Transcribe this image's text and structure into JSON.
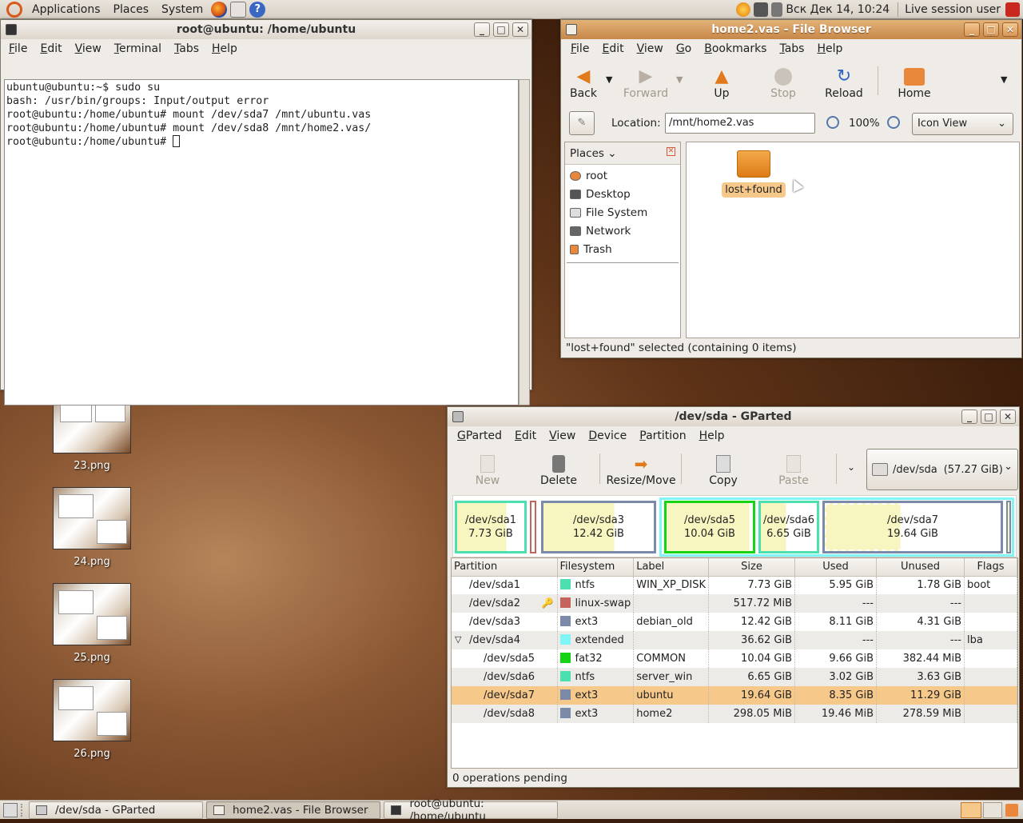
{
  "top_panel": {
    "menus": [
      "Applications",
      "Places",
      "System"
    ],
    "clock": "Вск Дек 14, 10:24",
    "session": "Live session user"
  },
  "terminal": {
    "title": "root@ubuntu: /home/ubuntu",
    "menu": [
      "File",
      "Edit",
      "View",
      "Terminal",
      "Tabs",
      "Help"
    ],
    "lines": [
      "ubuntu@ubuntu:~$ sudo su",
      "bash: /usr/bin/groups: Input/output error",
      "root@ubuntu:/home/ubuntu# mount /dev/sda7 /mnt/ubuntu.vas",
      "root@ubuntu:/home/ubuntu# mount /dev/sda8 /mnt/home2.vas/",
      "root@ubuntu:/home/ubuntu# "
    ]
  },
  "file_browser": {
    "title": "home2.vas - File Browser",
    "menu": [
      "File",
      "Edit",
      "View",
      "Go",
      "Bookmarks",
      "Tabs",
      "Help"
    ],
    "toolbar": {
      "back": "Back",
      "forward": "Forward",
      "up": "Up",
      "stop": "Stop",
      "reload": "Reload",
      "home": "Home"
    },
    "location_label": "Location:",
    "location": "/mnt/home2.vas",
    "zoom": "100%",
    "view_mode": "Icon View",
    "places_label": "Places",
    "places": [
      "root",
      "Desktop",
      "File System",
      "Network",
      "Trash"
    ],
    "item": "lost+found",
    "status": "\"lost+found\" selected (containing 0 items)"
  },
  "gparted": {
    "title": "/dev/sda - GParted",
    "menu": [
      "GParted",
      "Edit",
      "View",
      "Device",
      "Partition",
      "Help"
    ],
    "toolbar": {
      "new": "New",
      "delete": "Delete",
      "resize": "Resize/Move",
      "copy": "Copy",
      "paste": "Paste"
    },
    "device": "/dev/sda",
    "device_size": "(57.27 GiB)",
    "map": [
      {
        "name": "/dev/sda1",
        "size": "7.73 GiB"
      },
      {
        "name": "/dev/sda3",
        "size": "12.42 GiB"
      },
      {
        "name": "/dev/sda5",
        "size": "10.04 GiB"
      },
      {
        "name": "/dev/sda6",
        "size": "6.65 GiB"
      },
      {
        "name": "/dev/sda7",
        "size": "19.64 GiB"
      }
    ],
    "columns": [
      "Partition",
      "Filesystem",
      "Label",
      "Size",
      "Used",
      "Unused",
      "Flags"
    ],
    "rows": [
      {
        "partition": "/dev/sda1",
        "fs": "ntfs",
        "color": "#4ce0b0",
        "label": "WIN_XP_DISK",
        "size": "7.73 GiB",
        "used": "5.95 GiB",
        "unused": "1.78 GiB",
        "flags": "boot"
      },
      {
        "partition": "/dev/sda2",
        "fs": "linux-swap",
        "color": "#c6635d",
        "label": "",
        "size": "517.72 MiB",
        "used": "---",
        "unused": "---",
        "flags": ""
      },
      {
        "partition": "/dev/sda3",
        "fs": "ext3",
        "color": "#7a8aa8",
        "label": "debian_old",
        "size": "12.42 GiB",
        "used": "8.11 GiB",
        "unused": "4.31 GiB",
        "flags": ""
      },
      {
        "partition": "/dev/sda4",
        "fs": "extended",
        "color": "#7ff5f5",
        "label": "",
        "size": "36.62 GiB",
        "used": "---",
        "unused": "---",
        "flags": "lba"
      },
      {
        "partition": "/dev/sda5",
        "fs": "fat32",
        "color": "#14d414",
        "label": "COMMON",
        "size": "10.04 GiB",
        "used": "9.66 GiB",
        "unused": "382.44 MiB",
        "flags": ""
      },
      {
        "partition": "/dev/sda6",
        "fs": "ntfs",
        "color": "#4ce0b0",
        "label": "server_win",
        "size": "6.65 GiB",
        "used": "3.02 GiB",
        "unused": "3.63 GiB",
        "flags": ""
      },
      {
        "partition": "/dev/sda7",
        "fs": "ext3",
        "color": "#7a8aa8",
        "label": "ubuntu",
        "size": "19.64 GiB",
        "used": "8.35 GiB",
        "unused": "11.29 GiB",
        "flags": ""
      },
      {
        "partition": "/dev/sda8",
        "fs": "ext3",
        "color": "#7a8aa8",
        "label": "home2",
        "size": "298.05 MiB",
        "used": "19.46 MiB",
        "unused": "278.59 MiB",
        "flags": ""
      }
    ],
    "status": "0 operations pending"
  },
  "desktop_icons": [
    "23.png",
    "24.png",
    "25.png",
    "26.png"
  ],
  "taskbar": [
    "/dev/sda - GParted",
    "home2.vas - File Browser",
    "root@ubuntu: /home/ubuntu"
  ]
}
